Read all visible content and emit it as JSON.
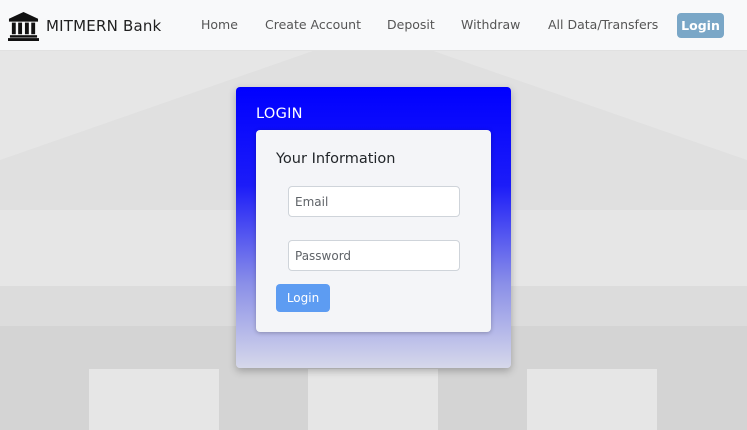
{
  "brand": {
    "name": "MITMERN Bank",
    "icon": "bank-icon"
  },
  "nav": {
    "items": [
      {
        "label": "Home"
      },
      {
        "label": "Create Account"
      },
      {
        "label": "Deposit"
      },
      {
        "label": "Withdraw"
      },
      {
        "label": "All Data/Transfers"
      }
    ],
    "login_label": "Login"
  },
  "card": {
    "title": "LOGIN",
    "subtitle": "Your Information",
    "email_placeholder": "Email",
    "password_placeholder": "Password",
    "submit_label": "Login"
  },
  "colors": {
    "card_gradient_top": "#0000ff",
    "card_gradient_bottom": "#d6d8ea",
    "submit_button": "#5d9cf2",
    "nav_login_button": "#7aa7c7",
    "background": "#e6e6e6"
  }
}
